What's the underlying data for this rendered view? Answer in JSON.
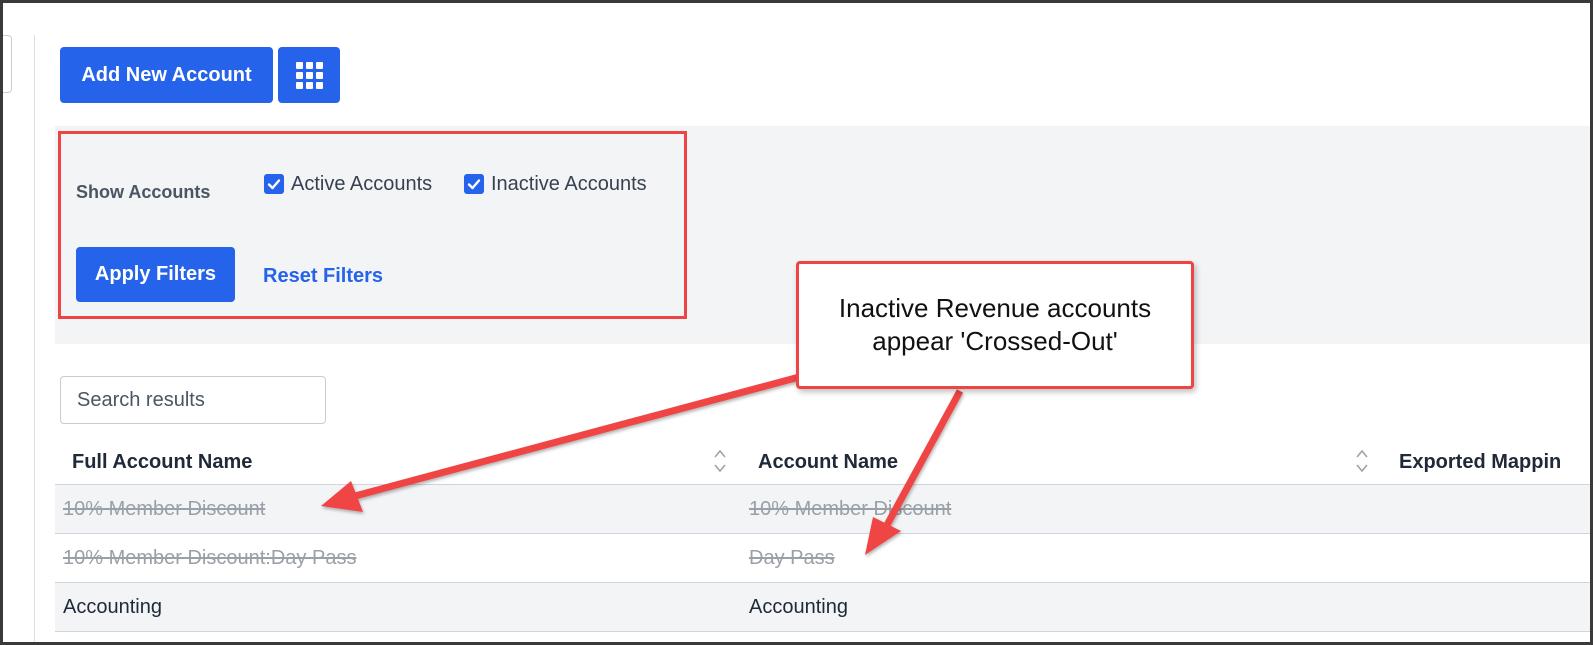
{
  "toolbar": {
    "add_account_label": "Add New Account",
    "grid_icon": "grid-icon"
  },
  "filters": {
    "show_label": "Show Accounts",
    "active_label": "Active Accounts",
    "active_checked": true,
    "inactive_label": "Inactive Accounts",
    "inactive_checked": true,
    "apply_label": "Apply Filters",
    "reset_label": "Reset Filters"
  },
  "search": {
    "placeholder": "Search results"
  },
  "table": {
    "columns": [
      "Full Account Name",
      "Account Name",
      "Exported Mappin"
    ],
    "rows": [
      {
        "full_name": "10% Member Discount",
        "account_name": "10% Member Discount",
        "status": "inactive"
      },
      {
        "full_name": "10% Member Discount:Day Pass",
        "account_name": "Day Pass",
        "status": "inactive"
      },
      {
        "full_name": "Accounting",
        "account_name": "Accounting",
        "status": "active"
      }
    ]
  },
  "annotation": {
    "callout_text": "Inactive Revenue accounts appear 'Crossed-Out'"
  },
  "colors": {
    "primary": "#2563eb",
    "highlight": "#ef4444",
    "inactive_text": "#9aa0a8"
  }
}
